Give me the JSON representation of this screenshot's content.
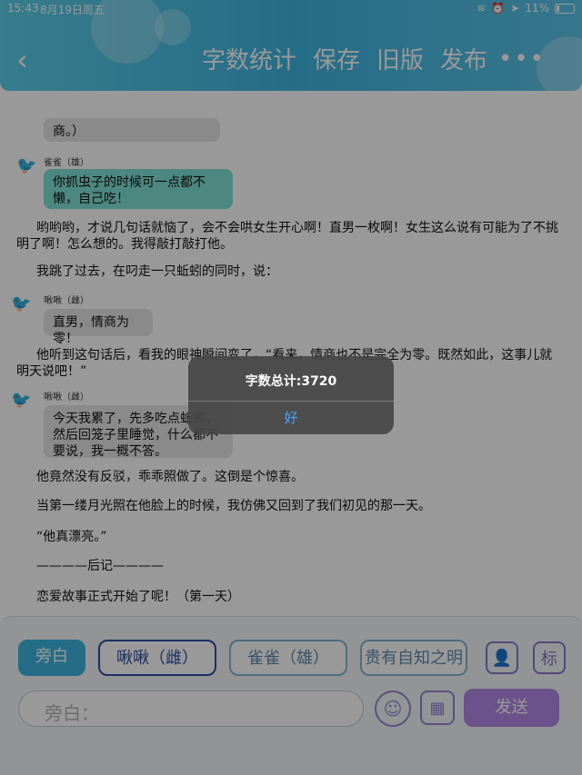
{
  "status_bar": {
    "time": "15:43",
    "date": "8月19日周五",
    "battery": "11%"
  },
  "header": {
    "back_label": "‹",
    "actions": [
      "字数统计",
      "保存",
      "旧版",
      "发布"
    ],
    "more_label": "•••"
  },
  "chat": {
    "top_bubble": "商。）",
    "message1": {
      "speaker": "雀雀（雄）",
      "text": "你抓虫子的时候可一点都不懒，自己吃！"
    },
    "para1": "哟哟哟，才说几句话就恼了，会不会哄女生开心啊！直男一枚啊！女生这么说有可能为了不挑明了啊！怎么想的。我得敲打敲打他。",
    "para2": "我跳了过去，在叼走一只蚯蚓的同时，说：",
    "message2": {
      "speaker": "啾啾（雌）",
      "text": "直男，情商为零！"
    },
    "para3": "他听到这句话后，看我的眼神瞬间变了，“看来，情商也不是完全为零。既然如此，这事儿就明天说吧！”",
    "message3": {
      "speaker": "啾啾（雌）",
      "text": "今天我累了，先多吃点蚯蚓，然后回笼子里睡觉，什么都不要说，我一概不答。"
    },
    "para4": "他竟然没有反驳，乖乖照做了。这倒是个惊喜。",
    "para5": "当第一缕月光照在他脸上的时候，我仿佛又回到了我们初见的那一天。",
    "para6": "“他真漂亮。”",
    "para7": "————后记————",
    "para8": "恋爱故事正式开始了呢！（第一天）"
  },
  "alert": {
    "title": "字数总计:3720",
    "button": "好"
  },
  "bottom": {
    "roles": [
      "旁白",
      "啾啾（雌）",
      "雀雀（雄）",
      "贵有自知之明"
    ],
    "input_placeholder": "旁白：",
    "send_label": "发送",
    "role_icon_label": "👤",
    "label_icon_label": "标"
  }
}
